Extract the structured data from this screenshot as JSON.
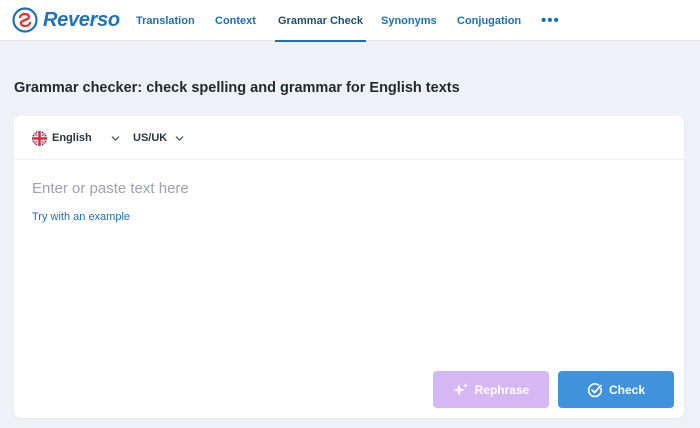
{
  "brand": {
    "name": "Reverso",
    "color": "#1d72b8"
  },
  "nav": {
    "items": [
      {
        "label": "Translation",
        "active": false
      },
      {
        "label": "Context",
        "active": false
      },
      {
        "label": "Grammar Check",
        "active": true
      },
      {
        "label": "Synonyms",
        "active": false
      },
      {
        "label": "Conjugation",
        "active": false
      }
    ],
    "more_label": "•••"
  },
  "page": {
    "heading_bold": "Grammar checker:",
    "heading_rest": " check spelling and grammar for English texts"
  },
  "editor": {
    "language": {
      "label": "English",
      "icon": "uk-flag-icon"
    },
    "variant": {
      "label": "US/UK"
    },
    "placeholder": "Enter or paste text here",
    "example_link": "Try with an example"
  },
  "actions": {
    "rephrase": {
      "label": "Rephrase",
      "icon": "sparkle-icon",
      "color": "#d5b7f3"
    },
    "check": {
      "label": "Check",
      "icon": "check-circle-icon",
      "color": "#3e93dc"
    }
  }
}
